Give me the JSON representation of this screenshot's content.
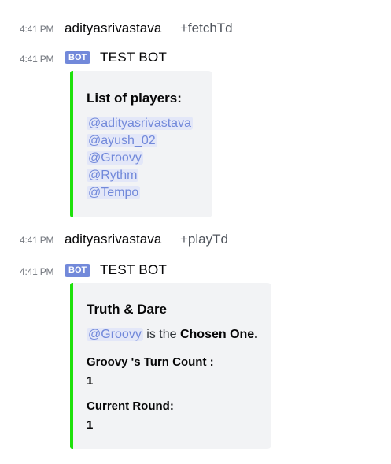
{
  "messages": [
    {
      "time": "4:41 PM",
      "author": "adityasrivastava",
      "command": "+fetchTd"
    },
    {
      "time": "4:41 PM",
      "bot_tag": "BOT",
      "author": "TEST BOT",
      "embed": {
        "title": "List of players:",
        "players": [
          "@adityasrivastava",
          "@ayush_02",
          "@Groovy",
          "@Rythm",
          "@Tempo"
        ],
        "accent": "#1ee10b"
      }
    },
    {
      "time": "4:41 PM",
      "author": "adityasrivastava",
      "command": "+playTd"
    },
    {
      "time": "4:41 PM",
      "bot_tag": "BOT",
      "author": "TEST BOT",
      "embed": {
        "title": "Truth & Dare",
        "mention": "@Groovy",
        "desc_text": "is the",
        "desc_bold": "Chosen One.",
        "fields": [
          {
            "name": "Groovy 's Turn Count :",
            "value": "1"
          },
          {
            "name": "Current Round:",
            "value": "1"
          }
        ],
        "accent": "#1ee10b"
      }
    }
  ],
  "colors": {
    "mention_text": "#7289da",
    "mention_bg": "#e3e7f8",
    "bot_tag_bg": "#7289da",
    "embed_bg": "#f2f3f5"
  }
}
